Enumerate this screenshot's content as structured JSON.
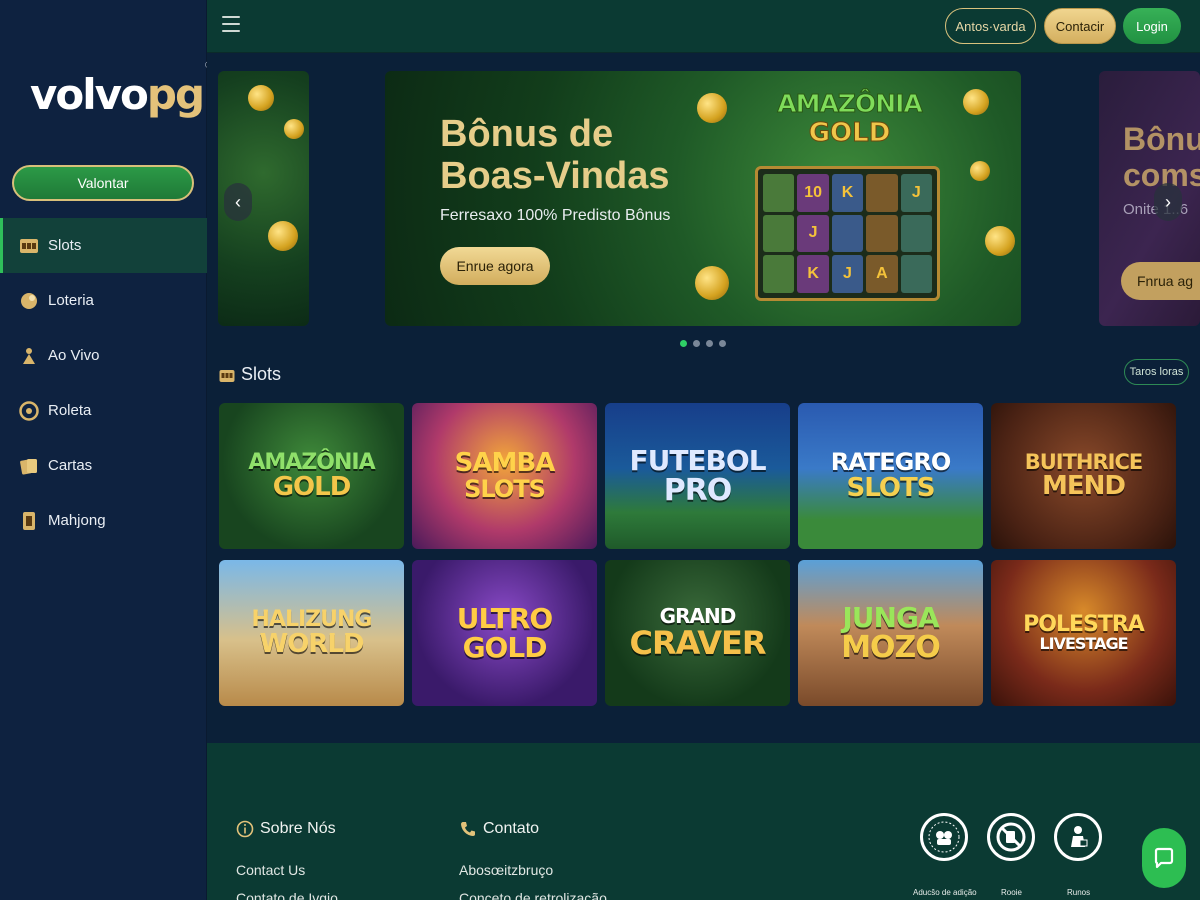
{
  "brand": {
    "part1": "volvo",
    "part2": "pg",
    "mark": "®"
  },
  "sidebar": {
    "cta_label": "Valontar",
    "items": [
      {
        "label": "Slots",
        "icon": "slot-machine-icon",
        "active": true
      },
      {
        "label": "Loteria",
        "icon": "lottery-ball-icon"
      },
      {
        "label": "Ao Vivo",
        "icon": "live-dealer-icon"
      },
      {
        "label": "Roleta",
        "icon": "roulette-icon"
      },
      {
        "label": "Cartas",
        "icon": "cards-icon"
      },
      {
        "label": "Mahjong",
        "icon": "mahjong-tile-icon"
      }
    ]
  },
  "header": {
    "menu_icon": "hamburger-icon",
    "buttons": {
      "outline": "Antos·varda",
      "gold": "Contacir",
      "login": "Login"
    }
  },
  "carousel": {
    "main": {
      "title_line1": "Bônus de",
      "title_line2": "Boas-Vindas",
      "subtitle": "Ferresaxo 100% Predisto Bônus",
      "button": "Enrue agora",
      "art_line1": "AMAZÔNIA",
      "art_line2": "GOLD",
      "reel_symbols": [
        "",
        "10",
        "K",
        "",
        "J",
        "",
        "J",
        "",
        "",
        "",
        "",
        "K",
        "J",
        "A",
        ""
      ]
    },
    "next": {
      "title_line1": "Bônu",
      "title_line2": "coms",
      "subtitle": "Onite 1..6",
      "button": "Fnrua ag"
    },
    "dots_total": 4,
    "dots_active": 1
  },
  "slots": {
    "title": "Slots",
    "see_all": "Taros loras",
    "games": [
      {
        "line1": "AMAZÔNIA",
        "line2": "GOLD"
      },
      {
        "line1": "SAMBA",
        "line2": "SLOTS"
      },
      {
        "line1": "FUTEBOL",
        "line2": "PRO"
      },
      {
        "line1": "RATEGRO",
        "line2": "SLOTS"
      },
      {
        "line1": "BUITHRICE",
        "line2": "MEND"
      },
      {
        "line1": "HALIZUNG",
        "line2": "WORLD"
      },
      {
        "line1": "ULTRO",
        "line2": "GOLD"
      },
      {
        "line1": "GRAND",
        "line2": "CRAVER"
      },
      {
        "line1": "JUNGA",
        "line2": "MOZO"
      },
      {
        "line1": "POLESTRA",
        "line2": "LIVESTAGE"
      }
    ]
  },
  "footer": {
    "about": {
      "title": "Sobre Nós",
      "links": [
        "Contact Us",
        "Contato de Ivgio"
      ]
    },
    "contact": {
      "title": "Contato",
      "links": [
        "Abosœitzbruço",
        "Conceto de retrolização"
      ]
    },
    "badges": [
      {
        "label": "Aducŝo de adição",
        "icon": "responsible-gaming-seal-icon"
      },
      {
        "label": "Rooie",
        "icon": "no-minors-icon"
      },
      {
        "label": "Runos",
        "icon": "self-exclusion-icon"
      }
    ],
    "chat_icon": "chat-bubble-icon"
  }
}
